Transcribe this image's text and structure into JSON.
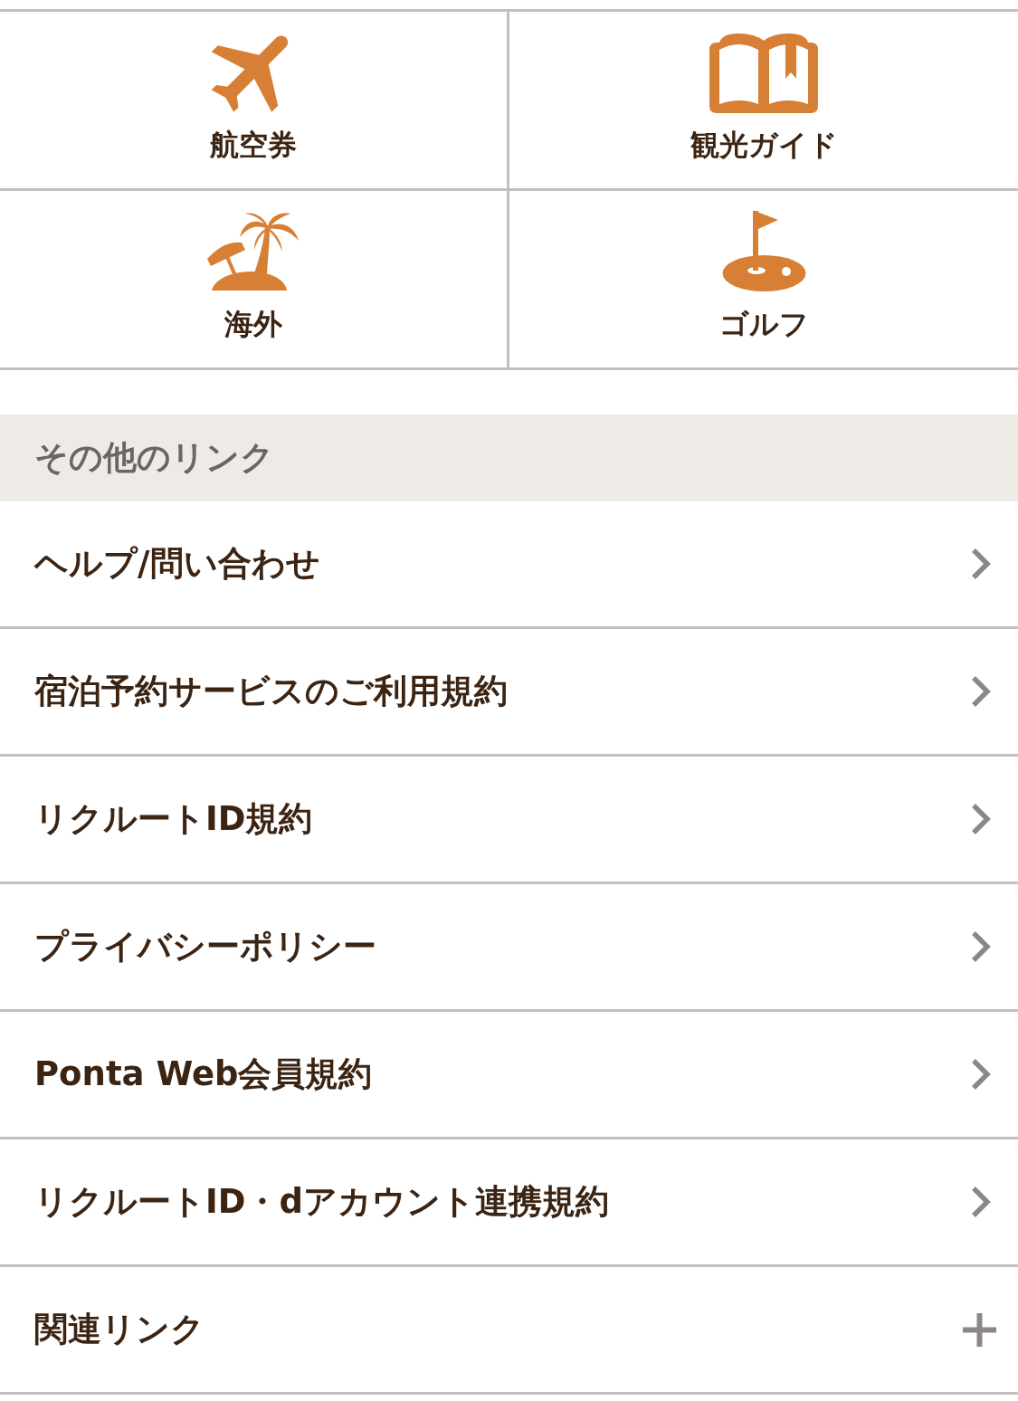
{
  "category_tiles": [
    {
      "kind": "airplane",
      "label": "航空券"
    },
    {
      "kind": "book",
      "label": "観光ガイド"
    },
    {
      "kind": "island",
      "label": "海外"
    },
    {
      "kind": "golf",
      "label": "ゴルフ"
    }
  ],
  "other_links": {
    "title": "その他のリンク",
    "items": [
      {
        "kind": "link",
        "label": "ヘルプ/問い合わせ"
      },
      {
        "kind": "link",
        "label": "宿泊予約サービスのご利用規約"
      },
      {
        "kind": "link",
        "label": "リクルートID規約"
      },
      {
        "kind": "link",
        "label": "プライバシーポリシー"
      },
      {
        "kind": "link",
        "label": "Ponta Web会員規約"
      },
      {
        "kind": "link",
        "label": "リクルートID・dアカウント連携規約"
      },
      {
        "kind": "accordion",
        "label": "関連リンク"
      }
    ]
  }
}
